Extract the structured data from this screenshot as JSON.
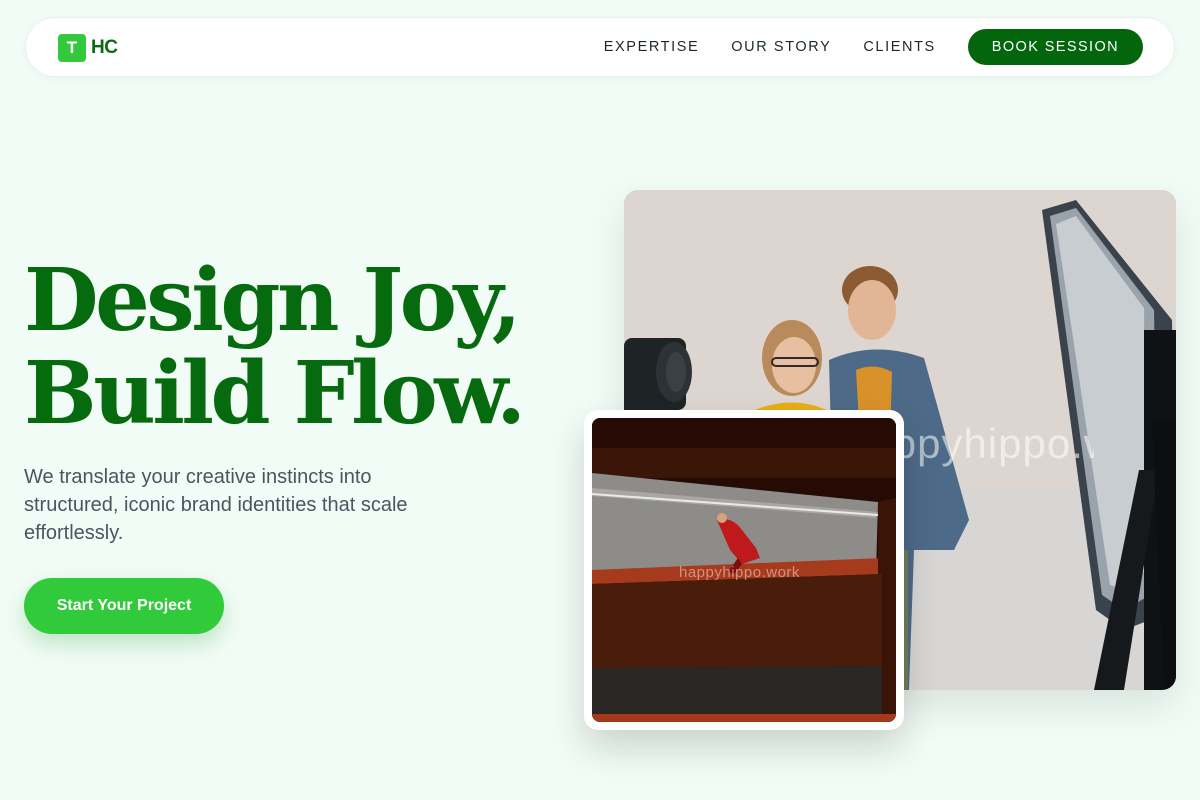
{
  "brand": {
    "mark": "T",
    "text": "HC",
    "accent": "#34c93c",
    "primary": "#03650c"
  },
  "nav": {
    "links": [
      "EXPERTISE",
      "OUR STORY",
      "CLIENTS"
    ],
    "cta": "BOOK SESSION"
  },
  "hero": {
    "headline_line1": "Design Joy,",
    "headline_line2": "Build Flow.",
    "subtext": "We translate your creative instincts into structured, iconic brand identities that scale effortlessly.",
    "cta": "Start Your Project"
  },
  "images": {
    "main": {
      "subject": "photo of two people reviewing work in a photo studio with lights and a softbox",
      "watermark": "happyhippo.work"
    },
    "inset": {
      "subject": "overhead photo of a person in red on a staircase landing",
      "watermark": "happyhippo.work"
    }
  },
  "icons": [
    "logo-mark-icon"
  ]
}
